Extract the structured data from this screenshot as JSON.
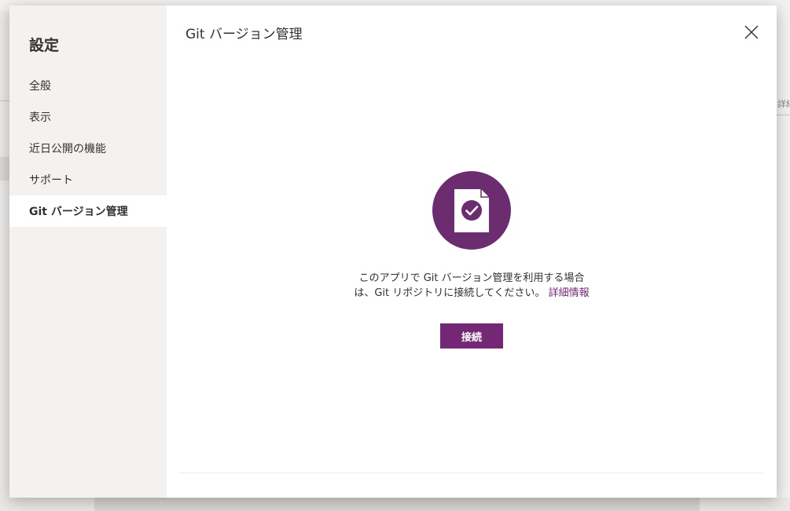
{
  "background": {
    "right_edge_text": "詳細設"
  },
  "sidebar": {
    "title": "設定",
    "items": [
      {
        "label": "全般",
        "selected": false
      },
      {
        "label": "表示",
        "selected": false
      },
      {
        "label": "近日公開の機能",
        "selected": false
      },
      {
        "label": "サポート",
        "selected": false
      },
      {
        "label": "Git バージョン管理",
        "selected": true
      }
    ]
  },
  "content": {
    "title": "Git バージョン管理",
    "close_icon": "close-icon",
    "center_icon": "document-check-icon",
    "message_line1": "このアプリで Git バージョン管理を利用する場合",
    "message_line2": "は、Git リポジトリに接続してください。",
    "learn_more_link": "詳細情報",
    "connect_button": "接続"
  },
  "colors": {
    "accent": "#742774",
    "icon_circle": "#6b2d6f",
    "sidebar_bg": "#f3f2f1"
  }
}
